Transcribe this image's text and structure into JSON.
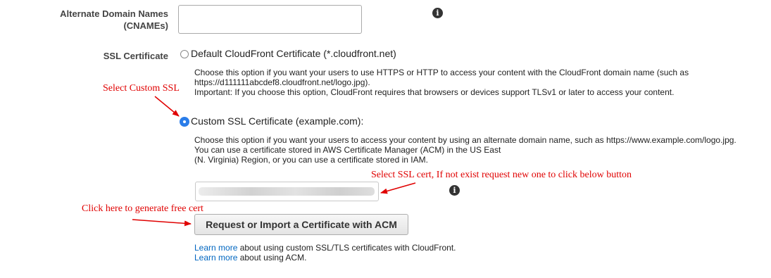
{
  "cname": {
    "label_line1": "Alternate Domain Names",
    "label_line2": "(CNAMEs)",
    "value": ""
  },
  "ssl": {
    "label": "SSL Certificate",
    "default_option": {
      "label": "Default CloudFront Certificate (*.cloudfront.net)",
      "desc_line1": "Choose this option if you want your users to use HTTPS or HTTP to access your content with the CloudFront domain name (such as",
      "desc_line2": "https://d111111abcdef8.cloudfront.net/logo.jpg).",
      "desc_line3": "Important: If you choose this option, CloudFront requires that browsers or devices support TLSv1 or later to access your content.",
      "selected": false
    },
    "custom_option": {
      "label": "Custom SSL Certificate (example.com):",
      "desc_line1": "Choose this option if you want your users to access your content by using an alternate domain name, such as https://www.example.com/logo.jpg.",
      "desc_line2": "You can use a certificate stored in AWS Certificate Manager (ACM) in the US East",
      "desc_line3": "(N. Virginia) Region, or you can use a certificate stored in IAM.",
      "selected": true
    },
    "acm_button": "Request or Import a Certificate with ACM",
    "learn1_link": "Learn more",
    "learn1_text": " about using custom SSL/TLS certificates with CloudFront.",
    "learn2_link": "Learn more",
    "learn2_text": " about using ACM."
  },
  "annotations": {
    "select_custom": "Select Custom SSL",
    "select_cert": "Select SSL cert, If not exist request new one to click below button",
    "generate": "Click here to generate free cert"
  },
  "colors": {
    "annotation": "#e00000",
    "link": "#0066c0",
    "radio_selected": "#2b7de9"
  }
}
